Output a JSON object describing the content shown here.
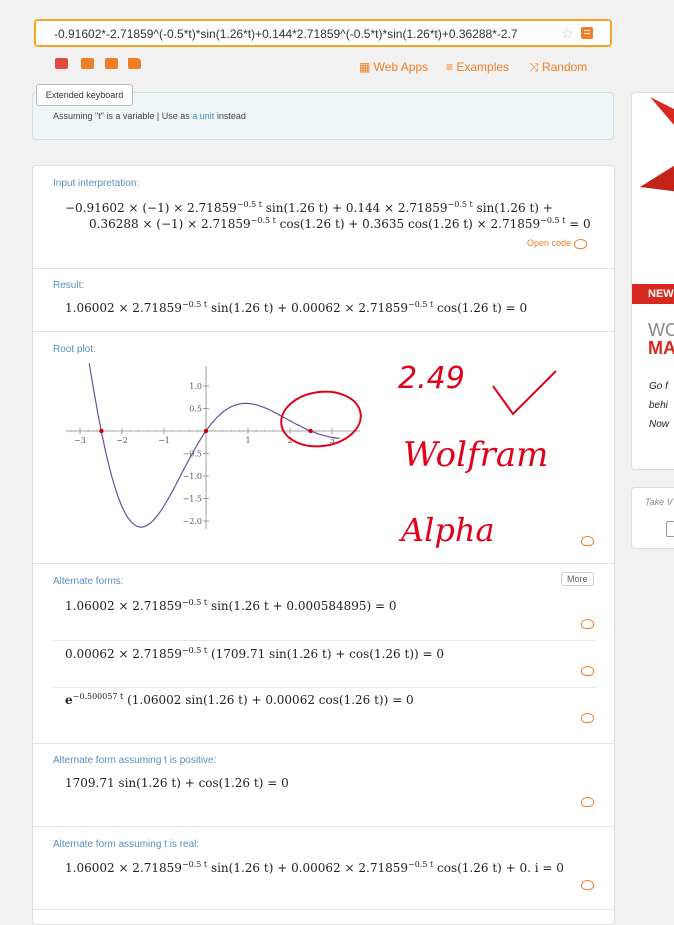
{
  "search": {
    "query": "-0.91602*-2.71859^(-0.5*t)*sin(1.26*t)+0.144*2.71859^(-0.5*t)*sin(1.26*t)+0.36288*-2.7"
  },
  "toolbar": {
    "web_apps": "Web Apps",
    "examples": "Examples",
    "random": "Random",
    "tooltip": "Extended keyboard"
  },
  "assumption": {
    "prefix": "Assuming \"t\" is a variable | Use as ",
    "link": "a unit",
    "suffix": " instead"
  },
  "pods": {
    "input": {
      "title": "Input interpretation:",
      "line1_a": "−0.91602 × (−1) × 2.71859",
      "line1_exp": "−0.5 t",
      "line1_b": " sin(1.26 t) + 0.144 × 2.71859",
      "line1_exp2": "−0.5 t",
      "line1_c": " sin(1.26 t) +",
      "line2_a": "0.36288 × (−1) × 2.71859",
      "line2_exp": "−0.5 t",
      "line2_b": " cos(1.26 t) + 0.3635 cos(1.26 t) × 2.71859",
      "line2_exp2": "−0.5 t",
      "line2_c": " = 0",
      "open_code": "Open code"
    },
    "result": {
      "title": "Result:",
      "a": "1.06002 × 2.71859",
      "exp": "−0.5 t",
      "b": " sin(1.26 t) + 0.00062 × 2.71859",
      "exp2": "−0.5 t",
      "c": " cos(1.26 t) = 0"
    },
    "root_plot": {
      "title": "Root plot:"
    },
    "alternate_forms": {
      "title": "Alternate forms:",
      "more": "More",
      "form1_a": "1.06002 × 2.71859",
      "form1_exp": "−0.5 t",
      "form1_b": " sin(1.26 t + 0.000584895) = 0",
      "form2_a": "0.00062 × 2.71859",
      "form2_exp": "−0.5 t",
      "form2_b": " (1709.71 sin(1.26 t) + cos(1.26 t)) = 0",
      "form3_a": "e",
      "form3_exp": "−0.500057 t",
      "form3_b": " (1.06002 sin(1.26 t) + 0.00062 cos(1.26 t)) = 0"
    },
    "positive": {
      "title": "Alternate form assuming t is positive:",
      "expr": "1709.71 sin(1.26 t) + cos(1.26 t) = 0"
    },
    "real": {
      "title": "Alternate form assuming t is real:",
      "a": "1.06002 × 2.71859",
      "exp": "−0.5 t",
      "b": " sin(1.26 t) + 0.00062 × 2.71859",
      "exp2": "−0.5 t",
      "c": " cos(1.26 t) + 0. i = 0"
    }
  },
  "plot": {
    "x_ticks": [
      "−3",
      "−2",
      "−1",
      "1",
      "2",
      "3"
    ],
    "y_ticks": [
      "1.0",
      "0.5",
      "−0.5",
      "−1.0",
      "−1.5",
      "−2.0"
    ],
    "roots": [
      -2.49,
      0,
      2.49
    ],
    "curve_color": "#6b4ea0",
    "root_color": "#cc0000"
  },
  "annotation": {
    "number": "2.49",
    "word1": "Wolfram",
    "word2": "Alpha",
    "color": "#e0001a"
  },
  "ad": {
    "badge": "NEW",
    "line1": "WO",
    "line2": "MA",
    "body1": "Go f",
    "body2": "behi",
    "body3": "Now"
  },
  "side2": {
    "text": "Take V"
  }
}
